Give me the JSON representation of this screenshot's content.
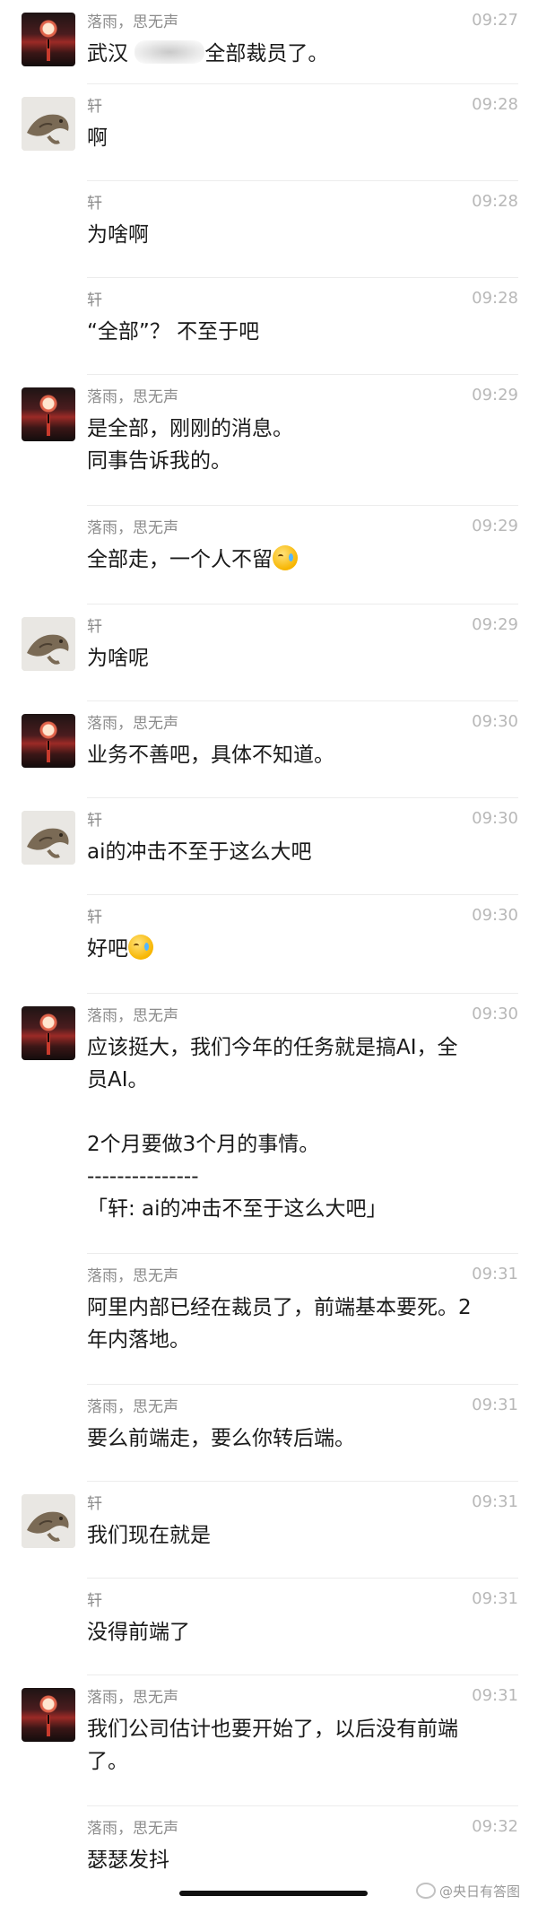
{
  "messages": [
    {
      "sender": "落雨，思无声",
      "time": "09:27",
      "avatar": "sunset",
      "text_before": "武汉 ",
      "text_after": "全部裁员了。"
    },
    {
      "sender": "轩",
      "time": "09:28",
      "avatar": "croc",
      "text": "啊"
    },
    {
      "sender": "轩",
      "time": "09:28",
      "avatar": "none",
      "text": "为啥啊"
    },
    {
      "sender": "轩",
      "time": "09:28",
      "avatar": "none",
      "text": "“全部”？ 不至于吧"
    },
    {
      "sender": "落雨，思无声",
      "time": "09:29",
      "avatar": "sunset",
      "text": "是全部，刚刚的消息。\n同事告诉我的。"
    },
    {
      "sender": "落雨，思无声",
      "time": "09:29",
      "avatar": "none",
      "text": "全部走，一个人不留",
      "emoji": "crying-laughing-emoji"
    },
    {
      "sender": "轩",
      "time": "09:29",
      "avatar": "croc",
      "text": "为啥呢"
    },
    {
      "sender": "落雨，思无声",
      "time": "09:30",
      "avatar": "sunset",
      "text": "业务不善吧，具体不知道。"
    },
    {
      "sender": "轩",
      "time": "09:30",
      "avatar": "croc",
      "text": "ai的冲击不至于这么大吧"
    },
    {
      "sender": "轩",
      "time": "09:30",
      "avatar": "none",
      "text": "好吧",
      "emoji": "crying-laughing-emoji"
    },
    {
      "sender": "落雨，思无声",
      "time": "09:30",
      "avatar": "sunset",
      "text": "应该挺大，我们今年的任务就是搞AI，全\n员AI。\n\n2个月要做3个月的事情。\n---------------\n「轩: ai的冲击不至于这么大吧」"
    },
    {
      "sender": "落雨，思无声",
      "time": "09:31",
      "avatar": "none",
      "text": "阿里内部已经在裁员了，前端基本要死。2\n年内落地。"
    },
    {
      "sender": "落雨，思无声",
      "time": "09:31",
      "avatar": "none",
      "text": "要么前端走，要么你转后端。"
    },
    {
      "sender": "轩",
      "time": "09:31",
      "avatar": "croc",
      "text": "我们现在就是"
    },
    {
      "sender": "轩",
      "time": "09:31",
      "avatar": "none",
      "text": "没得前端了"
    },
    {
      "sender": "落雨，思无声",
      "time": "09:31",
      "avatar": "sunset",
      "text": "我们公司估计也要开始了，以后没有前端\n了。"
    },
    {
      "sender": "落雨，思无声",
      "time": "09:32",
      "avatar": "none",
      "text": "瑟瑟发抖"
    }
  ],
  "watermark": "@央日有答图"
}
